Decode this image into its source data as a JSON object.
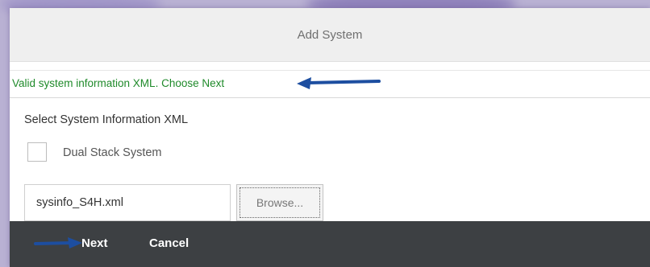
{
  "dialog": {
    "title": "Add System",
    "status_message": "Valid system information XML. Choose Next",
    "section_label": "Select System Information XML",
    "dual_stack": {
      "label": "Dual Stack System",
      "checked": false
    },
    "file_input": {
      "value": "sysinfo_S4H.xml"
    },
    "browse_label": "Browse...",
    "footer": {
      "next_label": "Next",
      "cancel_label": "Cancel"
    }
  },
  "colors": {
    "status_text": "#1f8a2a",
    "footer_bg": "#3d4043",
    "arrow": "#1d4ea0",
    "background": "#b9b1d3"
  },
  "icons": [
    "arrow-left-icon",
    "arrow-right-icon"
  ]
}
